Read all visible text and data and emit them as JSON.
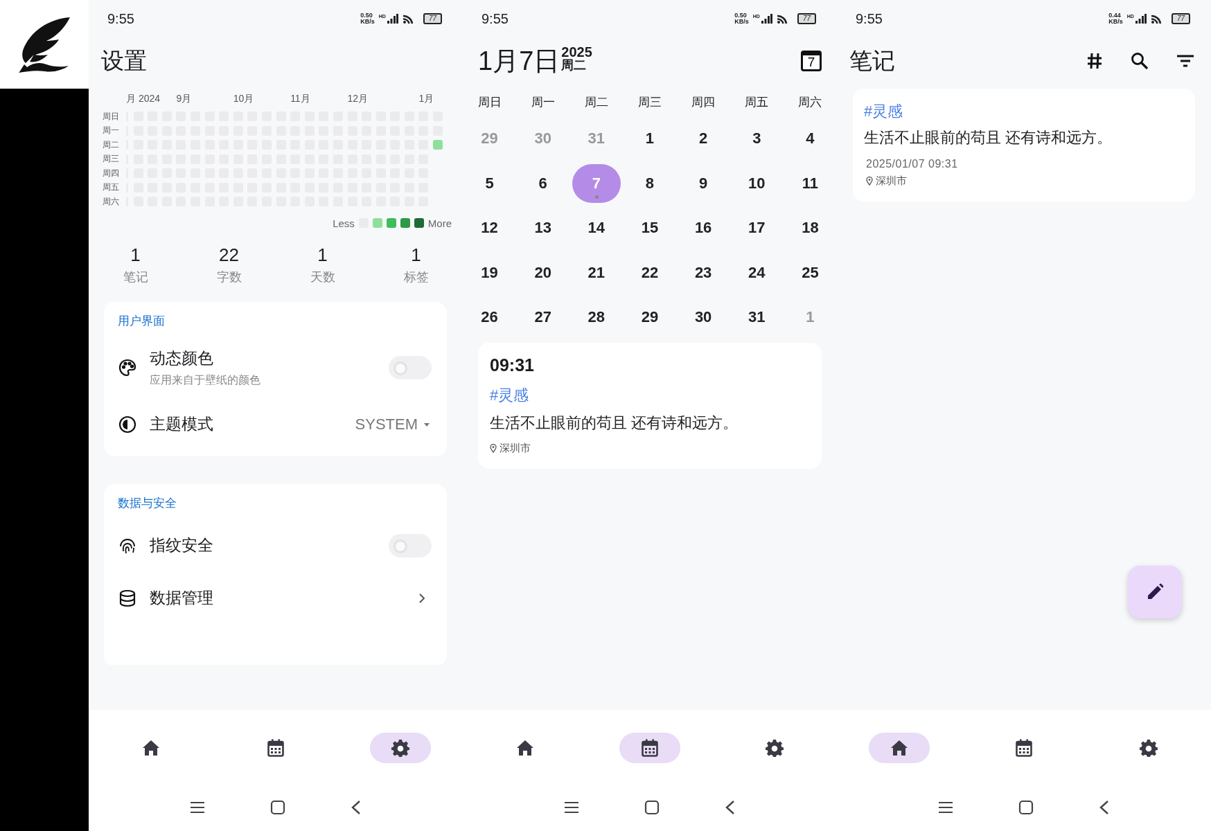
{
  "screens": [
    {
      "kind": "settings",
      "status_bar": {
        "time": "9:55",
        "speed": "0.50",
        "speed_unit": "KB/s",
        "network": "HD",
        "battery": "77"
      },
      "title": "设置",
      "heatmap": {
        "months": [
          "月 2024",
          "9月",
          "10月",
          "11月",
          "12月",
          "1月"
        ],
        "rows": [
          "周日",
          "周一",
          "周二",
          "周三",
          "周四",
          "周五",
          "周六"
        ],
        "latest_week": [
          {
            "active": false
          },
          {
            "active": false
          },
          {
            "active": true
          }
        ],
        "less": "Less",
        "more": "More",
        "legend": [
          {
            "color": "#ebebed"
          },
          {
            "color": "#8fdf9c"
          },
          {
            "color": "#3dbe5b"
          },
          {
            "color": "#2c9a48"
          },
          {
            "color": "#1f6b35"
          }
        ]
      },
      "stats": [
        {
          "value": "1",
          "label": "笔记"
        },
        {
          "value": "22",
          "label": "字数"
        },
        {
          "value": "1",
          "label": "天数"
        },
        {
          "value": "1",
          "label": "标签"
        }
      ],
      "sections": [
        {
          "title": "用户界面",
          "items": [
            {
              "kind": "toggle",
              "label": "动态颜色",
              "subtitle": "应用来自于壁纸的颜色",
              "on": false
            },
            {
              "kind": "dropdown",
              "label": "主题模式",
              "value": "SYSTEM"
            }
          ]
        },
        {
          "title": "数据与安全",
          "items": [
            {
              "kind": "toggle",
              "label": "指纹安全",
              "on": false
            },
            {
              "kind": "link",
              "label": "数据管理"
            }
          ]
        }
      ],
      "bottom_nav": [
        {
          "kind": "home",
          "selected": false
        },
        {
          "kind": "calendar",
          "selected": false
        },
        {
          "kind": "settings",
          "selected": true
        }
      ]
    },
    {
      "kind": "calendar",
      "status_bar": {
        "time": "9:55",
        "speed": "0.50",
        "speed_unit": "KB/s",
        "network": "HD",
        "battery": "77"
      },
      "date": "1月7日",
      "year": "2025",
      "weekday": "周二",
      "calendar_day": "7",
      "weekdays": [
        "周日",
        "周一",
        "周二",
        "周三",
        "周四",
        "周五",
        "周六"
      ],
      "days": [
        {
          "day": "29",
          "muted": true,
          "selected": false,
          "has_note": false
        },
        {
          "day": "30",
          "muted": true,
          "selected": false,
          "has_note": false
        },
        {
          "day": "31",
          "muted": true,
          "selected": false,
          "has_note": false
        },
        {
          "day": "1",
          "muted": false,
          "selected": false,
          "has_note": false
        },
        {
          "day": "2",
          "muted": false,
          "selected": false,
          "has_note": false
        },
        {
          "day": "3",
          "muted": false,
          "selected": false,
          "has_note": false
        },
        {
          "day": "4",
          "muted": false,
          "selected": false,
          "has_note": false
        },
        {
          "day": "5",
          "muted": false,
          "selected": false,
          "has_note": false
        },
        {
          "day": "6",
          "muted": false,
          "selected": false,
          "has_note": false
        },
        {
          "day": "7",
          "muted": false,
          "selected": true,
          "has_note": true
        },
        {
          "day": "8",
          "muted": false,
          "selected": false,
          "has_note": false
        },
        {
          "day": "9",
          "muted": false,
          "selected": false,
          "has_note": false
        },
        {
          "day": "10",
          "muted": false,
          "selected": false,
          "has_note": false
        },
        {
          "day": "11",
          "muted": false,
          "selected": false,
          "has_note": false
        },
        {
          "day": "12",
          "muted": false,
          "selected": false,
          "has_note": false
        },
        {
          "day": "13",
          "muted": false,
          "selected": false,
          "has_note": false
        },
        {
          "day": "14",
          "muted": false,
          "selected": false,
          "has_note": false
        },
        {
          "day": "15",
          "muted": false,
          "selected": false,
          "has_note": false
        },
        {
          "day": "16",
          "muted": false,
          "selected": false,
          "has_note": false
        },
        {
          "day": "17",
          "muted": false,
          "selected": false,
          "has_note": false
        },
        {
          "day": "18",
          "muted": false,
          "selected": false,
          "has_note": false
        },
        {
          "day": "19",
          "muted": false,
          "selected": false,
          "has_note": false
        },
        {
          "day": "20",
          "muted": false,
          "selected": false,
          "has_note": false
        },
        {
          "day": "21",
          "muted": false,
          "selected": false,
          "has_note": false
        },
        {
          "day": "22",
          "muted": false,
          "selected": false,
          "has_note": false
        },
        {
          "day": "23",
          "muted": false,
          "selected": false,
          "has_note": false
        },
        {
          "day": "24",
          "muted": false,
          "selected": false,
          "has_note": false
        },
        {
          "day": "25",
          "muted": false,
          "selected": false,
          "has_note": false
        },
        {
          "day": "26",
          "muted": false,
          "selected": false,
          "has_note": false
        },
        {
          "day": "27",
          "muted": false,
          "selected": false,
          "has_note": false
        },
        {
          "day": "28",
          "muted": false,
          "selected": false,
          "has_note": false
        },
        {
          "day": "29",
          "muted": false,
          "selected": false,
          "has_note": false
        },
        {
          "day": "30",
          "muted": false,
          "selected": false,
          "has_note": false
        },
        {
          "day": "31",
          "muted": false,
          "selected": false,
          "has_note": false
        },
        {
          "day": "1",
          "muted": true,
          "selected": false,
          "has_note": false
        }
      ],
      "event": {
        "time": "09:31",
        "tag": "#灵感",
        "text": "生活不止眼前的苟且 还有诗和远方。",
        "location": "深圳市"
      },
      "bottom_nav": [
        {
          "kind": "home",
          "selected": false
        },
        {
          "kind": "calendar",
          "selected": true
        },
        {
          "kind": "settings",
          "selected": false
        }
      ]
    },
    {
      "kind": "notes",
      "status_bar": {
        "time": "9:55",
        "speed": "0.44",
        "speed_unit": "KB/s",
        "network": "HD",
        "battery": "77"
      },
      "title": "笔记",
      "notes": [
        {
          "tag": "#灵感",
          "text": "生活不止眼前的苟且 还有诗和远方。",
          "datetime": "2025/01/07 09:31",
          "location": "深圳市"
        }
      ],
      "bottom_nav": [
        {
          "kind": "home",
          "selected": true
        },
        {
          "kind": "calendar",
          "selected": false
        },
        {
          "kind": "settings",
          "selected": false
        }
      ]
    }
  ]
}
